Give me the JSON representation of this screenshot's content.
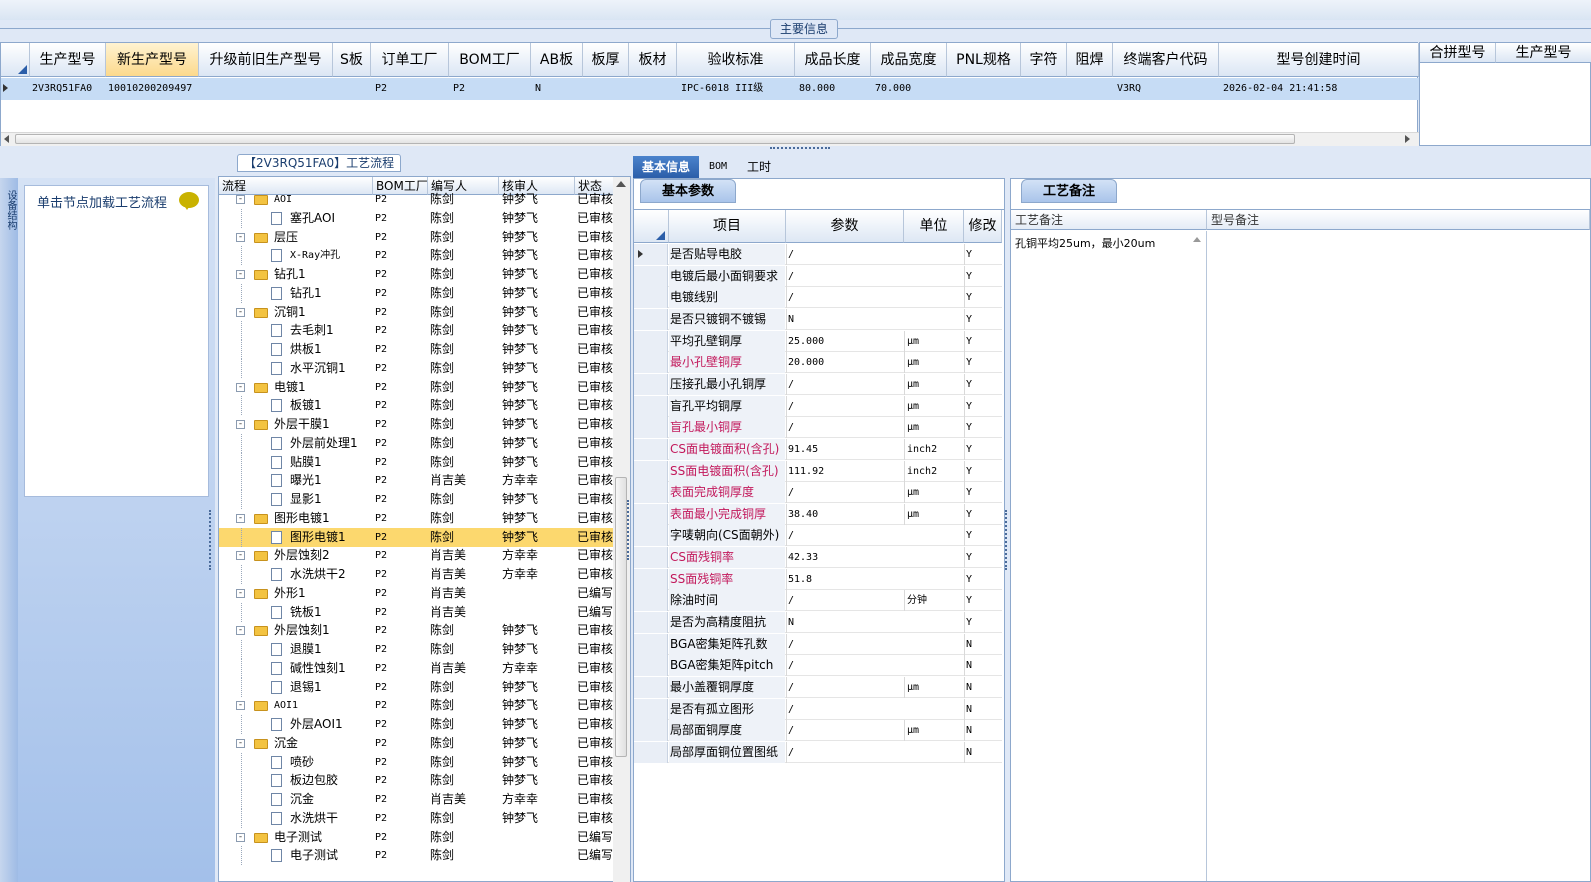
{
  "top_group": {
    "label": "主要信息"
  },
  "main_grid": {
    "headers": [
      "生产型号",
      "新生产型号",
      "升级前旧生产型号",
      "S板",
      "订单工厂",
      "BOM工厂",
      "AB板",
      "板厚",
      "板材",
      "验收标准",
      "成品长度",
      "成品宽度",
      "PNL规格",
      "字符",
      "阻焊",
      "终端客户代码",
      "型号创建时间"
    ],
    "row": [
      "2V3RQ51FA0",
      "10010200209497",
      "",
      "",
      "P2",
      "P2",
      "N",
      "",
      "",
      "IPC-6018 III级",
      "80.000",
      "70.000",
      "",
      "",
      "",
      "V3RQ",
      "2026-02-04 21:41:58"
    ]
  },
  "right_grid": {
    "headers": [
      "合拼型号",
      "生产型号"
    ]
  },
  "left_panel": {
    "strip_label": "设备结构",
    "node_prompt": "单击节点加载工艺流程"
  },
  "tree": {
    "title": "【2V3RQ51FA0】工艺流程",
    "headers": [
      "流程",
      "BOM工厂",
      "编写人",
      "核审人",
      "状态"
    ],
    "rows": [
      {
        "level": 0,
        "name": "AOI",
        "bom": "P2",
        "writer": "陈剑",
        "reviewer": "钟梦飞",
        "status": "已审核"
      },
      {
        "level": 1,
        "name": "塞孔AOI",
        "bom": "P2",
        "writer": "陈剑",
        "reviewer": "钟梦飞",
        "status": "已审核"
      },
      {
        "level": 0,
        "name": "层压",
        "bom": "P2",
        "writer": "陈剑",
        "reviewer": "钟梦飞",
        "status": "已审核"
      },
      {
        "level": 1,
        "name": "X-Ray冲孔",
        "bom": "P2",
        "writer": "陈剑",
        "reviewer": "钟梦飞",
        "status": "已审核"
      },
      {
        "level": 0,
        "name": "钻孔1",
        "bom": "P2",
        "writer": "陈剑",
        "reviewer": "钟梦飞",
        "status": "已审核"
      },
      {
        "level": 1,
        "name": "钻孔1",
        "bom": "P2",
        "writer": "陈剑",
        "reviewer": "钟梦飞",
        "status": "已审核"
      },
      {
        "level": 0,
        "name": "沉铜1",
        "bom": "P2",
        "writer": "陈剑",
        "reviewer": "钟梦飞",
        "status": "已审核"
      },
      {
        "level": 1,
        "name": "去毛刺1",
        "bom": "P2",
        "writer": "陈剑",
        "reviewer": "钟梦飞",
        "status": "已审核"
      },
      {
        "level": 1,
        "name": "烘板1",
        "bom": "P2",
        "writer": "陈剑",
        "reviewer": "钟梦飞",
        "status": "已审核"
      },
      {
        "level": 1,
        "name": "水平沉铜1",
        "bom": "P2",
        "writer": "陈剑",
        "reviewer": "钟梦飞",
        "status": "已审核"
      },
      {
        "level": 0,
        "name": "电镀1",
        "bom": "P2",
        "writer": "陈剑",
        "reviewer": "钟梦飞",
        "status": "已审核"
      },
      {
        "level": 1,
        "name": "板镀1",
        "bom": "P2",
        "writer": "陈剑",
        "reviewer": "钟梦飞",
        "status": "已审核"
      },
      {
        "level": 0,
        "name": "外层干膜1",
        "bom": "P2",
        "writer": "陈剑",
        "reviewer": "钟梦飞",
        "status": "已审核"
      },
      {
        "level": 1,
        "name": "外层前处理1",
        "bom": "P2",
        "writer": "陈剑",
        "reviewer": "钟梦飞",
        "status": "已审核"
      },
      {
        "level": 1,
        "name": "贴膜1",
        "bom": "P2",
        "writer": "陈剑",
        "reviewer": "钟梦飞",
        "status": "已审核"
      },
      {
        "level": 1,
        "name": "曝光1",
        "bom": "P2",
        "writer": "肖吉美",
        "reviewer": "方幸幸",
        "status": "已审核"
      },
      {
        "level": 1,
        "name": "显影1",
        "bom": "P2",
        "writer": "陈剑",
        "reviewer": "钟梦飞",
        "status": "已审核"
      },
      {
        "level": 0,
        "name": "图形电镀1",
        "bom": "P2",
        "writer": "陈剑",
        "reviewer": "钟梦飞",
        "status": "已审核"
      },
      {
        "level": 1,
        "name": "图形电镀1",
        "bom": "P2",
        "writer": "陈剑",
        "reviewer": "钟梦飞",
        "status": "已审核",
        "selected": true
      },
      {
        "level": 0,
        "name": "外层蚀刻2",
        "bom": "P2",
        "writer": "肖吉美",
        "reviewer": "方幸幸",
        "status": "已审核"
      },
      {
        "level": 1,
        "name": "水洗烘干2",
        "bom": "P2",
        "writer": "肖吉美",
        "reviewer": "方幸幸",
        "status": "已审核"
      },
      {
        "level": 0,
        "name": "外形1",
        "bom": "P2",
        "writer": "肖吉美",
        "reviewer": "",
        "status": "已编写"
      },
      {
        "level": 1,
        "name": "铣板1",
        "bom": "P2",
        "writer": "肖吉美",
        "reviewer": "",
        "status": "已编写"
      },
      {
        "level": 0,
        "name": "外层蚀刻1",
        "bom": "P2",
        "writer": "陈剑",
        "reviewer": "钟梦飞",
        "status": "已审核"
      },
      {
        "level": 1,
        "name": "退膜1",
        "bom": "P2",
        "writer": "陈剑",
        "reviewer": "钟梦飞",
        "status": "已审核"
      },
      {
        "level": 1,
        "name": "碱性蚀刻1",
        "bom": "P2",
        "writer": "肖吉美",
        "reviewer": "方幸幸",
        "status": "已审核"
      },
      {
        "level": 1,
        "name": "退锡1",
        "bom": "P2",
        "writer": "陈剑",
        "reviewer": "钟梦飞",
        "status": "已审核"
      },
      {
        "level": 0,
        "name": "AOI1",
        "bom": "P2",
        "writer": "陈剑",
        "reviewer": "钟梦飞",
        "status": "已审核"
      },
      {
        "level": 1,
        "name": "外层AOI1",
        "bom": "P2",
        "writer": "陈剑",
        "reviewer": "钟梦飞",
        "status": "已审核"
      },
      {
        "level": 0,
        "name": "沉金",
        "bom": "P2",
        "writer": "陈剑",
        "reviewer": "钟梦飞",
        "status": "已审核"
      },
      {
        "level": 1,
        "name": "喷砂",
        "bom": "P2",
        "writer": "陈剑",
        "reviewer": "钟梦飞",
        "status": "已审核"
      },
      {
        "level": 1,
        "name": "板边包胶",
        "bom": "P2",
        "writer": "陈剑",
        "reviewer": "钟梦飞",
        "status": "已审核"
      },
      {
        "level": 1,
        "name": "沉金",
        "bom": "P2",
        "writer": "肖吉美",
        "reviewer": "方幸幸",
        "status": "已审核"
      },
      {
        "level": 1,
        "name": "水洗烘干",
        "bom": "P2",
        "writer": "陈剑",
        "reviewer": "钟梦飞",
        "status": "已审核"
      },
      {
        "level": 0,
        "name": "电子测试",
        "bom": "P2",
        "writer": "陈剑",
        "reviewer": "",
        "status": "已编写"
      },
      {
        "level": 1,
        "name": "电子测试",
        "bom": "P2",
        "writer": "陈剑",
        "reviewer": "",
        "status": "已编写"
      }
    ]
  },
  "tabs": [
    "基本信息",
    "BOM",
    "工时"
  ],
  "basic": {
    "subtab": "基本参数",
    "headers": [
      "项目",
      "参数",
      "单位",
      "修改"
    ],
    "rows": [
      {
        "name": "是否贴导电胶",
        "value": "/",
        "unit": "",
        "mod": "Y",
        "red": false
      },
      {
        "name": "电镀后最小面铜要求",
        "value": "/",
        "unit": "",
        "mod": "Y",
        "red": false
      },
      {
        "name": "电镀线别",
        "value": "/",
        "unit": "",
        "mod": "Y",
        "red": false
      },
      {
        "name": "是否只镀铜不镀锡",
        "value": "N",
        "unit": "",
        "mod": "Y",
        "red": false
      },
      {
        "name": "平均孔壁铜厚",
        "value": "25.000",
        "unit": "μm",
        "mod": "Y",
        "red": false
      },
      {
        "name": "最小孔壁铜厚",
        "value": "20.000",
        "unit": "μm",
        "mod": "Y",
        "red": true
      },
      {
        "name": "压接孔最小孔铜厚",
        "value": "/",
        "unit": "μm",
        "mod": "Y",
        "red": false
      },
      {
        "name": "盲孔平均铜厚",
        "value": "/",
        "unit": "μm",
        "mod": "Y",
        "red": false
      },
      {
        "name": "盲孔最小铜厚",
        "value": "/",
        "unit": "μm",
        "mod": "Y",
        "red": true
      },
      {
        "name": "CS面电镀面积(含孔)",
        "value": "91.45",
        "unit": "inch2",
        "mod": "Y",
        "red": true
      },
      {
        "name": "SS面电镀面积(含孔)",
        "value": "111.92",
        "unit": "inch2",
        "mod": "Y",
        "red": true
      },
      {
        "name": "表面完成铜厚度",
        "value": "/",
        "unit": "μm",
        "mod": "Y",
        "red": true
      },
      {
        "name": "表面最小完成铜厚",
        "value": "38.40",
        "unit": "μm",
        "mod": "Y",
        "red": true
      },
      {
        "name": "字唛朝向(CS面朝外)",
        "value": "/",
        "unit": "",
        "mod": "Y",
        "red": false
      },
      {
        "name": "CS面残铜率",
        "value": "42.33",
        "unit": "",
        "mod": "Y",
        "red": true
      },
      {
        "name": "SS面残铜率",
        "value": "51.8",
        "unit": "",
        "mod": "Y",
        "red": true
      },
      {
        "name": "除油时间",
        "value": "/",
        "unit": "分钟",
        "mod": "Y",
        "red": false
      },
      {
        "name": "是否为高精度阻抗",
        "value": "N",
        "unit": "",
        "mod": "Y",
        "red": false
      },
      {
        "name": "BGA密集矩阵孔数",
        "value": "/",
        "unit": "",
        "mod": "N",
        "red": false
      },
      {
        "name": "BGA密集矩阵pitch",
        "value": "/",
        "unit": "",
        "mod": "N",
        "red": false
      },
      {
        "name": "最小盖覆铜厚度",
        "value": "/",
        "unit": "μm",
        "mod": "N",
        "red": false
      },
      {
        "name": "是否有孤立图形",
        "value": "/",
        "unit": "",
        "mod": "N",
        "red": false
      },
      {
        "name": "局部面铜厚度",
        "value": "/",
        "unit": "μm",
        "mod": "N",
        "red": false
      },
      {
        "name": "局部厚面铜位置图纸",
        "value": "/",
        "unit": "",
        "mod": "N",
        "red": false
      }
    ]
  },
  "notes": {
    "tab": "工艺备注",
    "col1": "工艺备注",
    "col2": "型号备注",
    "text": "孔铜平均25um，最小20um"
  },
  "colors": {
    "panel_bg": "#dfe8f6",
    "border": "#8da8cc",
    "selected_row": "#fcd86e",
    "highlight_header": "#fcd98c",
    "red_label": "#c2185b"
  }
}
